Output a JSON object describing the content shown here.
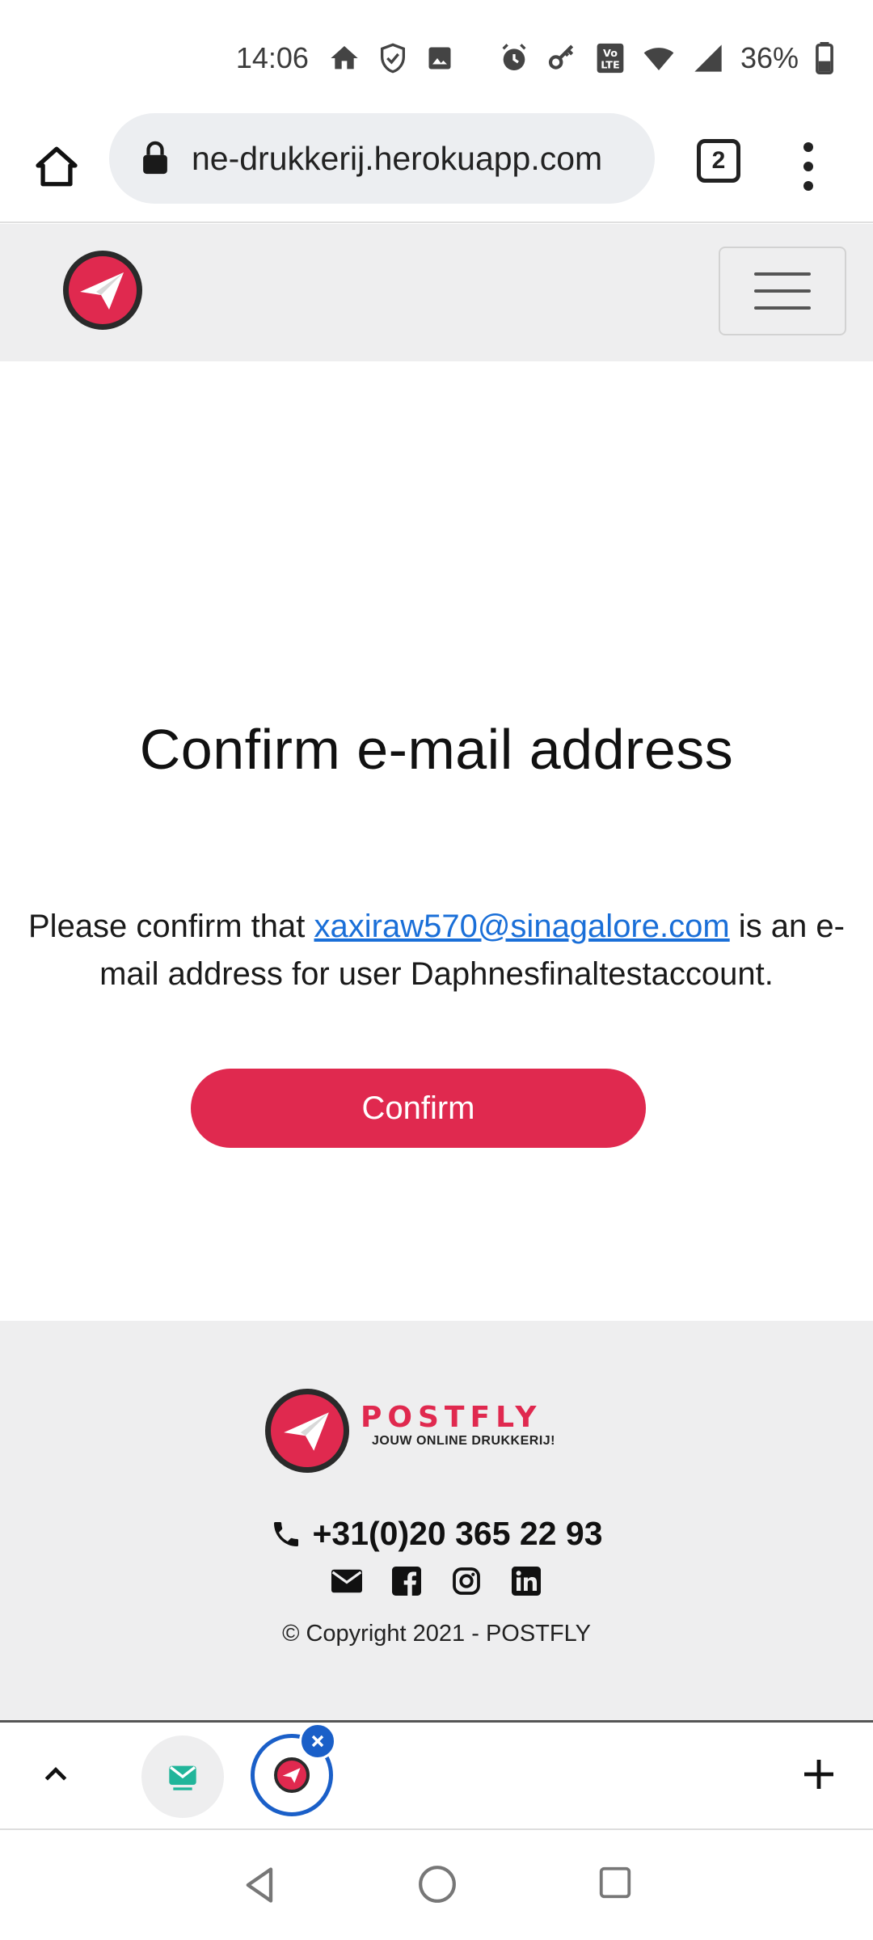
{
  "status_bar": {
    "time": "14:06",
    "battery": "36%",
    "icons": [
      "home-icon",
      "shield-icon",
      "image-icon",
      "alarm-icon",
      "key-icon",
      "volte-icon",
      "wifi-icon",
      "signal-icon",
      "battery-icon"
    ]
  },
  "browser": {
    "url": "ne-drukkerij.herokuapp.com",
    "tab_count": "2",
    "icons": [
      "home-icon",
      "lock-icon",
      "more-vert-icon"
    ]
  },
  "site_nav": {
    "logo_icon": "paper-plane-icon",
    "menu_icon": "hamburger-icon"
  },
  "main": {
    "title": "Confirm e-mail address",
    "message_prefix": "Please confirm that ",
    "email": "xaxiraw570@sinagalore.com",
    "message_suffix": " is an e-mail address for user Daphnesfinaltestaccount.",
    "confirm_label": "Confirm"
  },
  "footer": {
    "brand_name": "POSTFLY",
    "brand_tagline": "JOUW ONLINE DRUKKERIJ!",
    "phone": "+31(0)20 365 22 93",
    "social_icons": [
      "mail-icon",
      "facebook-icon",
      "instagram-icon",
      "linkedin-icon"
    ],
    "copyright": "© Copyright 2021 - POSTFLY"
  },
  "colors": {
    "brand_red": "#e0294f",
    "link_blue": "#1a6fd8",
    "nav_bg": "#eeeeef",
    "tab_blue": "#1a5fc8"
  }
}
